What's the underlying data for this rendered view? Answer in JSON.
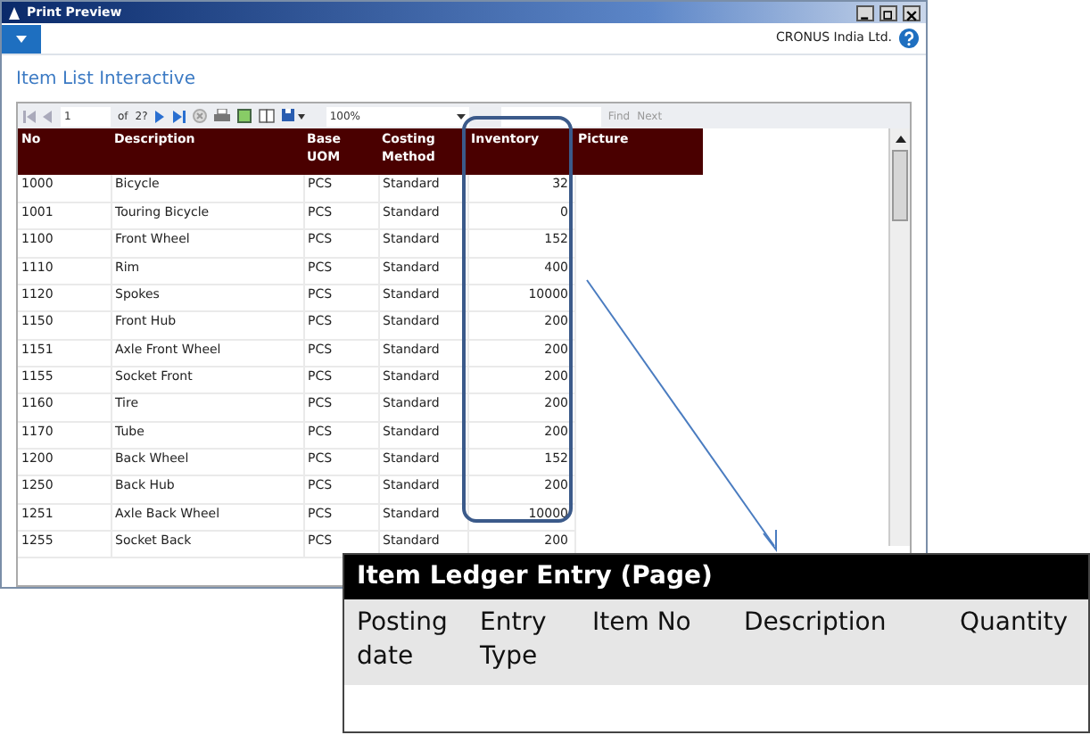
{
  "window": {
    "title": "Print Preview",
    "company": "CRONUS India Ltd.",
    "page_title": "Item List Interactive"
  },
  "toolbar": {
    "page": "1",
    "of": "of",
    "total": "2?",
    "zoom": "100%",
    "find": "Find",
    "next": "Next"
  },
  "table": {
    "columns": [
      "No",
      "Description",
      "Base UOM",
      "Costing Method",
      "Inventory",
      "Picture"
    ],
    "rows": [
      [
        "1000",
        "Bicycle",
        "PCS",
        "Standard",
        "32"
      ],
      [
        "1001",
        "Touring Bicycle",
        "PCS",
        "Standard",
        "0"
      ],
      [
        "1100",
        "Front Wheel",
        "PCS",
        "Standard",
        "152"
      ],
      [
        "1110",
        "Rim",
        "PCS",
        "Standard",
        "400"
      ],
      [
        "1120",
        "Spokes",
        "PCS",
        "Standard",
        "10000"
      ],
      [
        "1150",
        "Front Hub",
        "PCS",
        "Standard",
        "200"
      ],
      [
        "1151",
        "Axle Front Wheel",
        "PCS",
        "Standard",
        "200"
      ],
      [
        "1155",
        "Socket Front",
        "PCS",
        "Standard",
        "200"
      ],
      [
        "1160",
        "Tire",
        "PCS",
        "Standard",
        "200"
      ],
      [
        "1170",
        "Tube",
        "PCS",
        "Standard",
        "200"
      ],
      [
        "1200",
        "Back Wheel",
        "PCS",
        "Standard",
        "152"
      ],
      [
        "1250",
        "Back Hub",
        "PCS",
        "Standard",
        "200"
      ],
      [
        "1251",
        "Axle Back Wheel",
        "PCS",
        "Standard",
        "10000"
      ],
      [
        "1255",
        "Socket Back",
        "PCS",
        "Standard",
        "200"
      ]
    ]
  },
  "callout": {
    "title": "Item Ledger Entry (Page)",
    "columns": [
      "Posting date",
      "Entry Type",
      "Item No",
      "Description",
      "Quantity"
    ]
  }
}
